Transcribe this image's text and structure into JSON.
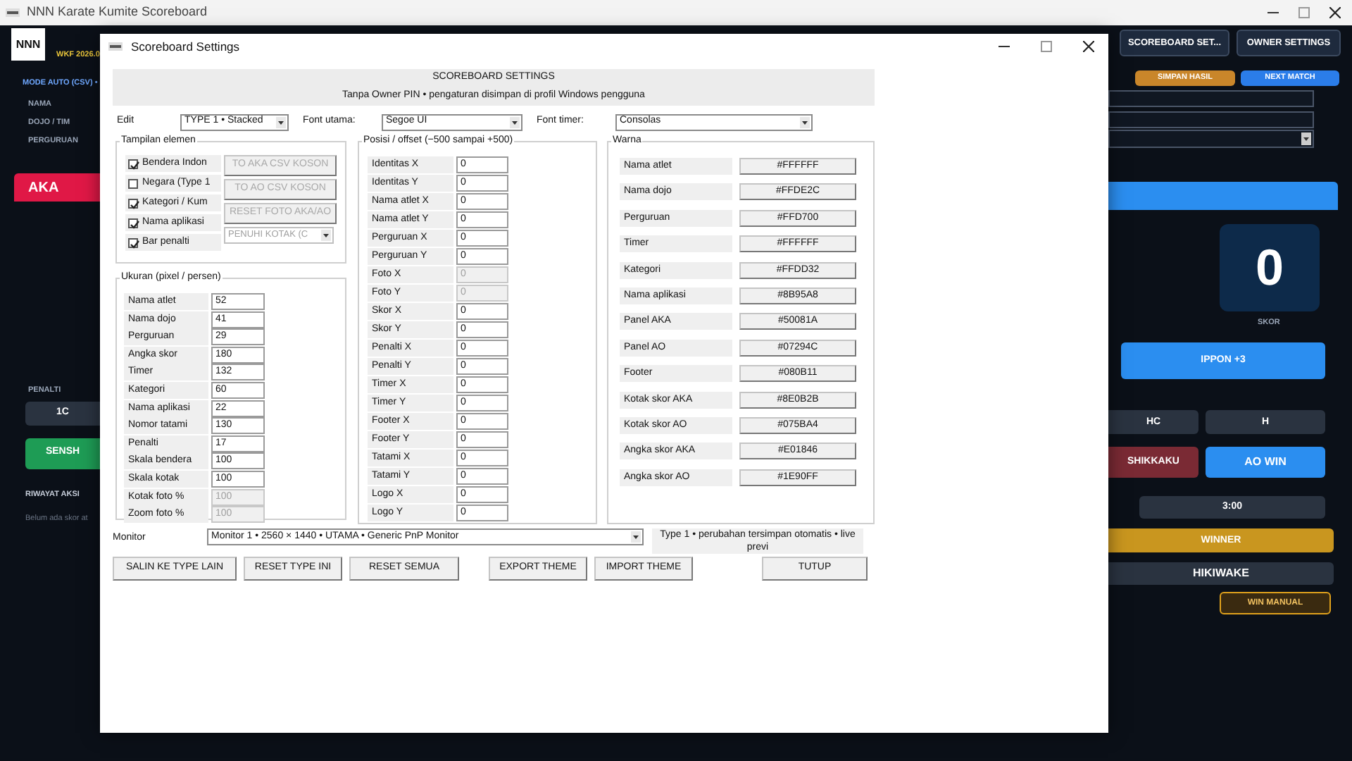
{
  "window": {
    "title": "NNN Karate Kumite Scoreboard"
  },
  "app": {
    "logo": "NNN",
    "version": "WKF 2026.0",
    "header_buttons": [
      "SCOREBOARD SET...",
      "OWNER SETTINGS"
    ],
    "mode": "MODE AUTO (CSV) •",
    "field_labels": [
      "NAMA",
      "DOJO / TIM",
      "PERGURUAN"
    ],
    "aka": "AKA",
    "penalty_label": "PENALTI",
    "penalty_left": "1C",
    "senshu": "SENSH",
    "history_title": "RIWAYAT AKSI",
    "history_empty": "Belum ada skor at",
    "save": "SIMPAN HASIL",
    "next": "NEXT MATCH",
    "score": "0",
    "score_label": "SKOR",
    "ippon": "IPPON +3",
    "penalties_right": [
      "HC",
      "H"
    ],
    "shikkaku": "SHIKKAKU",
    "ao_win": "AO WIN",
    "timer": "3:00",
    "winner": "WINNER",
    "hikiwake": "HIKIWAKE",
    "win_manual": "WIN MANUAL"
  },
  "dialog": {
    "title": "Scoreboard Settings",
    "heading": "SCOREBOARD SETTINGS",
    "subtitle": "Tanpa Owner PIN • pengaturan disimpan di profil Windows pengguna",
    "toolbar": [
      {
        "label": "Edit",
        "value": "TYPE 1 • Stacked"
      },
      {
        "label": "Font utama:",
        "value": "Segoe UI"
      },
      {
        "label": "Font timer:",
        "value": "Consolas"
      }
    ],
    "elements": {
      "title": "Tampilan elemen",
      "checks": [
        {
          "label": "Bendera Indon",
          "checked": true
        },
        {
          "label": "Negara (Type 1",
          "checked": false
        },
        {
          "label": "Kategori / Kum",
          "checked": true
        },
        {
          "label": "Nama aplikasi",
          "checked": true
        },
        {
          "label": "Bar penalti",
          "checked": true
        }
      ],
      "controls": [
        {
          "kind": "button",
          "label": "TO AKA CSV KOSON",
          "disabled": true
        },
        {
          "kind": "button",
          "label": "TO AO CSV KOSON",
          "disabled": true
        },
        {
          "kind": "button",
          "label": "RESET FOTO AKA/AO",
          "disabled": true
        },
        {
          "kind": "dropdown",
          "label": "PENUHI KOTAK (C",
          "disabled": true
        }
      ]
    },
    "sizes": {
      "title": "Ukuran (pixel / persen)",
      "rows": [
        {
          "label": "Nama atlet",
          "value": "52",
          "disabled": false
        },
        {
          "label": "Nama dojo",
          "value": "41",
          "disabled": false
        },
        {
          "label": "Perguruan",
          "value": "29",
          "disabled": false
        },
        {
          "label": "Angka skor",
          "value": "180",
          "disabled": false
        },
        {
          "label": "Timer",
          "value": "132",
          "disabled": false
        },
        {
          "label": "Kategori",
          "value": "60",
          "disabled": false
        },
        {
          "label": "Nama aplikasi",
          "value": "22",
          "disabled": false
        },
        {
          "label": "Nomor tatami",
          "value": "130",
          "disabled": false
        },
        {
          "label": "Penalti",
          "value": "17",
          "disabled": false
        },
        {
          "label": "Skala bendera",
          "value": "100",
          "disabled": false
        },
        {
          "label": "Skala kotak",
          "value": "100",
          "disabled": false
        },
        {
          "label": "Kotak foto %",
          "value": "100",
          "disabled": true
        },
        {
          "label": "Zoom foto %",
          "value": "100",
          "disabled": true
        }
      ]
    },
    "positions": {
      "title": "Posisi / offset (−500 sampai +500)",
      "rows": [
        {
          "label": "Identitas X",
          "value": "0",
          "disabled": false
        },
        {
          "label": "Identitas Y",
          "value": "0",
          "disabled": false
        },
        {
          "label": "Nama atlet X",
          "value": "0",
          "disabled": false
        },
        {
          "label": "Nama atlet Y",
          "value": "0",
          "disabled": false
        },
        {
          "label": "Perguruan X",
          "value": "0",
          "disabled": false
        },
        {
          "label": "Perguruan Y",
          "value": "0",
          "disabled": false
        },
        {
          "label": "Foto X",
          "value": "0",
          "disabled": true
        },
        {
          "label": "Foto Y",
          "value": "0",
          "disabled": true
        },
        {
          "label": "Skor X",
          "value": "0",
          "disabled": false
        },
        {
          "label": "Skor Y",
          "value": "0",
          "disabled": false
        },
        {
          "label": "Penalti X",
          "value": "0",
          "disabled": false
        },
        {
          "label": "Penalti Y",
          "value": "0",
          "disabled": false
        },
        {
          "label": "Timer X",
          "value": "0",
          "disabled": false
        },
        {
          "label": "Timer Y",
          "value": "0",
          "disabled": false
        },
        {
          "label": "Footer X",
          "value": "0",
          "disabled": false
        },
        {
          "label": "Footer Y",
          "value": "0",
          "disabled": false
        },
        {
          "label": "Tatami X",
          "value": "0",
          "disabled": false
        },
        {
          "label": "Tatami Y",
          "value": "0",
          "disabled": false
        },
        {
          "label": "Logo X",
          "value": "0",
          "disabled": false
        },
        {
          "label": "Logo Y",
          "value": "0",
          "disabled": false
        }
      ]
    },
    "colors": {
      "title": "Warna",
      "rows": [
        {
          "label": "Nama atlet",
          "value": "#FFFFFF"
        },
        {
          "label": "Nama dojo",
          "value": "#FFDE2C"
        },
        {
          "label": "Perguruan",
          "value": "#FFD700"
        },
        {
          "label": "Timer",
          "value": "#FFFFFF"
        },
        {
          "label": "Kategori",
          "value": "#FFDD32"
        },
        {
          "label": "Nama aplikasi",
          "value": "#8B95A8"
        },
        {
          "label": "Panel AKA",
          "value": "#50081A"
        },
        {
          "label": "Panel AO",
          "value": "#07294C"
        },
        {
          "label": "Footer",
          "value": "#080B11"
        },
        {
          "label": "Kotak skor AKA",
          "value": "#8E0B2B"
        },
        {
          "label": "Kotak skor AO",
          "value": "#075BA4"
        },
        {
          "label": "Angka skor AKA",
          "value": "#E01846"
        },
        {
          "label": "Angka skor AO",
          "value": "#1E90FF"
        }
      ]
    },
    "monitor": {
      "label": "Monitor",
      "value": "Monitor 1 • 2560 × 1440 • UTAMA • Generic PnP Monitor"
    },
    "status": "Type 1 • perubahan tersimpan otomatis • live previ",
    "buttons": {
      "left": [
        "SALIN KE TYPE LAIN",
        "RESET TYPE INI",
        "RESET SEMUA"
      ],
      "middle": [
        "EXPORT THEME",
        "IMPORT THEME"
      ],
      "close": "TUTUP"
    }
  }
}
